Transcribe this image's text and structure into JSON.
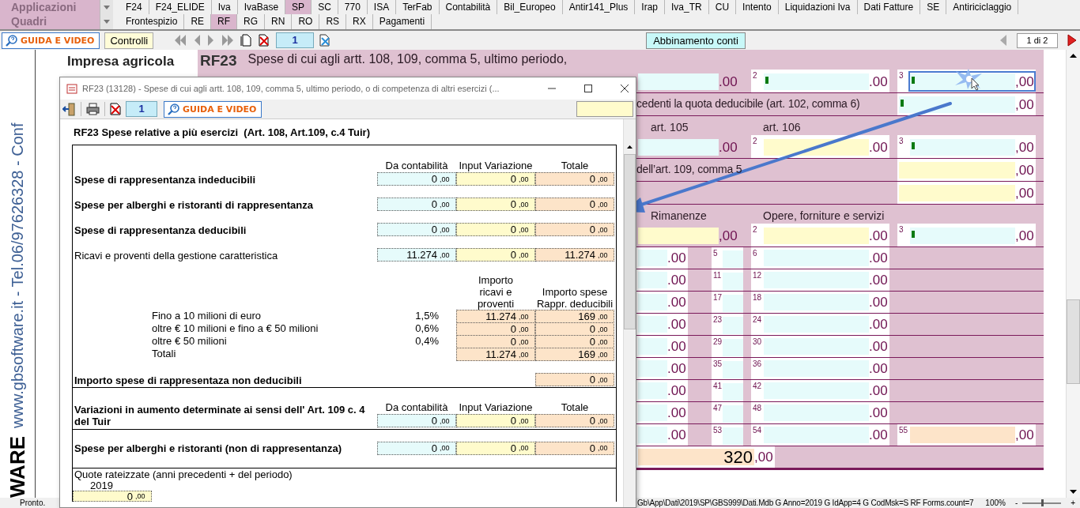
{
  "app_menu": {
    "label": "Applicazioni",
    "tabs": [
      {
        "label": "F24",
        "selected": false
      },
      {
        "label": "F24_ELIDE",
        "selected": false
      },
      {
        "label": "Iva",
        "selected": false
      },
      {
        "label": "IvaBase",
        "selected": false
      },
      {
        "label": "SP",
        "selected": true
      },
      {
        "label": "SC",
        "selected": false
      },
      {
        "label": "770",
        "selected": false
      },
      {
        "label": "ISA",
        "selected": false
      },
      {
        "label": "TerFab",
        "selected": false
      },
      {
        "label": "Contabilità",
        "selected": false
      },
      {
        "label": "Bil_Europeo",
        "selected": false
      },
      {
        "label": "Antir141_Plus",
        "selected": false
      },
      {
        "label": "Irap",
        "selected": false
      },
      {
        "label": "Iva_TR",
        "selected": false
      },
      {
        "label": "CU",
        "selected": false
      },
      {
        "label": "Intento",
        "selected": false
      },
      {
        "label": "Liquidazioni Iva",
        "selected": false
      },
      {
        "label": "Dati Fatture",
        "selected": false
      },
      {
        "label": "SE",
        "selected": false
      },
      {
        "label": "Antiriciclaggio",
        "selected": false
      }
    ]
  },
  "section_menu": {
    "label": "Quadri",
    "tabs": [
      {
        "label": "Frontespizio",
        "selected": false
      },
      {
        "label": "RE",
        "selected": false
      },
      {
        "label": "RF",
        "selected": true
      },
      {
        "label": "RG",
        "selected": false
      },
      {
        "label": "RN",
        "selected": false
      },
      {
        "label": "RO",
        "selected": false
      },
      {
        "label": "RS",
        "selected": false
      },
      {
        "label": "RX",
        "selected": false
      },
      {
        "label": "Pagamenti",
        "selected": false
      }
    ]
  },
  "toolbar": {
    "guide": "GUIDA E VIDEO",
    "controls": "Controlli",
    "record": "1",
    "match": "Abbinamento conti",
    "page": "1 di 2"
  },
  "banner": {
    "text": "www.gbsoftware.it - Tel.06/97626328 - Conf",
    "logo": "WARE"
  },
  "form": {
    "company": [
      "Impresa agricola"
    ],
    "code": "RF23",
    "title": "Spese di cui agli artt. 108, 109, comma 5, ultimo periodo,",
    "rows": [
      {
        "kind": "fields",
        "cells": [
          {
            "value": ".00",
            "kind": "account",
            "focused": false
          },
          {
            "num": "2",
            "value": ".00",
            "kind": "account",
            "marker": true,
            "focused": false
          },
          {
            "num": "3",
            "value": ",00",
            "kind": "account",
            "marker": true,
            "focused": true
          }
        ]
      },
      {
        "kind": "text",
        "text": "cedenti la quota deducibile (art. 102, comma 6)",
        "field": {
          "value": ",00",
          "kind": "account",
          "marker": true
        }
      },
      {
        "kind": "labels",
        "labels": [
          "art. 105",
          "art. 106"
        ]
      },
      {
        "kind": "fields",
        "cells": [
          {
            "value": ".00",
            "kind": "account",
            "focused": false
          },
          {
            "num": "2",
            "value": ".00",
            "kind": "input",
            "focused": false
          },
          {
            "num": "3",
            "value": ",00",
            "kind": "account",
            "marker": true,
            "focused": false
          }
        ]
      },
      {
        "kind": "text",
        "text": "dell’art. 109, comma 5",
        "field": {
          "value": ",00",
          "kind": "input"
        }
      },
      {
        "kind": "text",
        "field": {
          "value": ",00",
          "kind": "input"
        }
      },
      {
        "kind": "labels",
        "labels": [
          "Rimanenze",
          "Opere, forniture e servizi"
        ]
      },
      {
        "kind": "fields",
        "cells": [
          {
            "value": ",00",
            "kind": "input",
            "focused": false
          },
          {
            "num": "2",
            "value": ".00",
            "kind": "input",
            "focused": false
          },
          {
            "num": "3",
            "value": ",00",
            "kind": "account",
            "marker": true,
            "focused": false
          }
        ]
      },
      {
        "kind": "grid",
        "left": {
          "value": ".00",
          "kind": "account"
        },
        "mid": {
          "num": "5",
          "kind": "account"
        },
        "right": {
          "num": "6",
          "value": ".00",
          "kind": "account"
        }
      },
      {
        "kind": "grid",
        "left": {
          "value": ".00",
          "kind": "account"
        },
        "mid": {
          "num": "11",
          "kind": "account"
        },
        "right": {
          "num": "12",
          "value": ".00",
          "kind": "account"
        }
      },
      {
        "kind": "grid",
        "left": {
          "value": ".00",
          "kind": "account"
        },
        "mid": {
          "num": "17",
          "kind": "account"
        },
        "right": {
          "num": "18",
          "value": ".00",
          "kind": "account"
        }
      },
      {
        "kind": "grid",
        "left": {
          "value": ".00",
          "kind": "account"
        },
        "mid": {
          "num": "23",
          "kind": "account"
        },
        "right": {
          "num": "24",
          "value": ".00",
          "kind": "account"
        }
      },
      {
        "kind": "grid",
        "left": {
          "value": ".00",
          "kind": "account"
        },
        "mid": {
          "num": "29",
          "kind": "account"
        },
        "right": {
          "num": "30",
          "value": ".00",
          "kind": "account"
        }
      },
      {
        "kind": "grid",
        "left": {
          "value": ".00",
          "kind": "account"
        },
        "mid": {
          "num": "35",
          "kind": "account"
        },
        "right": {
          "num": "36",
          "value": ".00",
          "kind": "account"
        }
      },
      {
        "kind": "grid",
        "left": {
          "value": ".00",
          "kind": "account"
        },
        "mid": {
          "num": "41",
          "kind": "account"
        },
        "right": {
          "num": "42",
          "value": ".00",
          "kind": "account"
        }
      },
      {
        "kind": "grid",
        "left": {
          "value": ".00",
          "kind": "account"
        },
        "mid": {
          "num": "47",
          "kind": "account"
        },
        "right": {
          "num": "48",
          "value": ".00",
          "kind": "account"
        }
      },
      {
        "kind": "grid",
        "left": {
          "value": ".00",
          "kind": "account"
        },
        "mid": {
          "num": "53",
          "kind": "account"
        },
        "right": {
          "num": "54",
          "value": ".00",
          "kind": "account"
        },
        "end": {
          "num": "55",
          "value": ",00",
          "kind": "total"
        }
      }
    ],
    "total": {
      "value": "320,00",
      "kind": "total"
    }
  },
  "dialog": {
    "title": "RF23 (13128) - Spese di cui agli artt. 108, 109, comma 5, ultimo periodo, o di competenza di altri esercizi (...",
    "record": "1",
    "guide": "GUIDA E VIDEO",
    "heading": "RF23 Spese relative a più esercizi  (Art. 108, Art.109, c.4 Tuir)",
    "columns": [
      "Da contabilità",
      "Input Variazione",
      "Totale"
    ],
    "rows": [
      {
        "label": "Spese di rappresentanza indeducibili",
        "bold": true,
        "values": [
          "0,00",
          "0,00",
          "0,00"
        ]
      },
      {
        "label": "Spese per alberghi e ristoranti di rappresentanza",
        "bold": true,
        "values": [
          "0,00",
          "0,00",
          "0,00"
        ]
      },
      {
        "label": "Spese di rappresentanza deducibili",
        "bold": true,
        "values": [
          "0,00",
          "0,00",
          "0,00"
        ]
      },
      {
        "label": "Ricavi e proventi della gestione caratteristica",
        "bold": false,
        "values": [
          "11.274,00",
          "0,00",
          "11.274,00"
        ]
      }
    ],
    "bracket_columns": [
      "Importo ricavi e proventi",
      "Importo spese Rappr. deducibili"
    ],
    "brackets": [
      {
        "label": "Fino a 10 milioni di euro",
        "rate": "1,5%",
        "values": [
          "11.274,00",
          "169,00"
        ]
      },
      {
        "label": "oltre € 10 milioni e fino a € 50 milioni",
        "rate": "0,6%",
        "values": [
          "0,00",
          "0,00"
        ]
      },
      {
        "label": "oltre € 50 milioni",
        "rate": "0,4%",
        "values": [
          "0,00",
          "0,00"
        ]
      },
      {
        "label": "Totali",
        "values": [
          "11.274,00",
          "169,00"
        ]
      }
    ],
    "non_deductible": {
      "label": "Importo spese di rappresentaza non deducibili",
      "value": "0,00"
    },
    "variation_columns": [
      "Da contabilità",
      "Input Variazione",
      "Totale"
    ],
    "variations": [
      {
        "label": "Variazioni in aumento determinate ai sensi dell' Art. 109 c. 4 del Tuir",
        "values": [
          "0,00",
          "0,00",
          "0,00"
        ]
      },
      {
        "label": "Spese per alberghi e ristoranti (non di rappresentanza)",
        "values": [
          "0,00",
          "0,00",
          "0,00"
        ]
      }
    ],
    "installments": {
      "label": "Quote rateizzate (anni precedenti + del periodo)",
      "year": "2019",
      "value": "0,00"
    }
  },
  "status_bar": {
    "state": "Pronto.",
    "path": "Gb\\App\\Dati\\2019\\SP\\GBS999\\Dati.Mdb G Anno=2019 G IdApp=4 G CodMsk=S RF Forms.count=7",
    "zoom": "100%",
    "minus": "-",
    "level": 0.5,
    "plus": "+"
  }
}
